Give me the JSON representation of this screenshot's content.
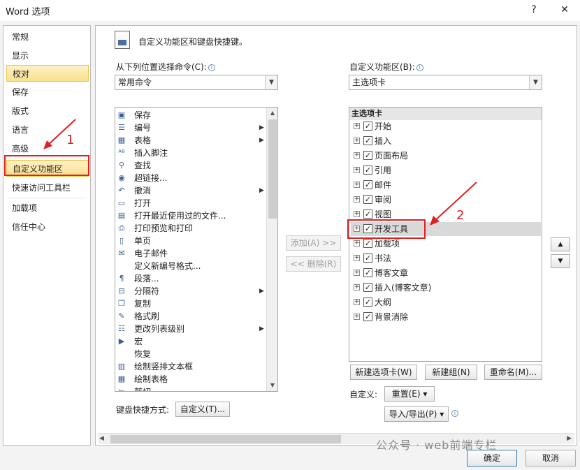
{
  "window": {
    "title": "Word 选项",
    "help": "?",
    "close": "✕"
  },
  "sidebar": {
    "items": [
      {
        "label": "常规"
      },
      {
        "label": "显示"
      },
      {
        "label": "校对"
      },
      {
        "label": "保存"
      },
      {
        "label": "版式"
      },
      {
        "label": "语言"
      },
      {
        "label": "高级"
      },
      {
        "label": "自定义功能区"
      },
      {
        "label": "快速访问工具栏"
      },
      {
        "label": "加载项"
      },
      {
        "label": "信任中心"
      }
    ]
  },
  "header": {
    "title": "自定义功能区和键盘快捷键。"
  },
  "left": {
    "label": "从下列位置选择命令(C):",
    "combo_value": "常用命令",
    "commands": [
      {
        "label": "保存",
        "icon": "save-icon",
        "glyph": "▣",
        "arrow": false
      },
      {
        "label": "编号",
        "icon": "numbering-icon",
        "glyph": "☰",
        "arrow": true
      },
      {
        "label": "表格",
        "icon": "table-icon",
        "glyph": "▦",
        "arrow": true
      },
      {
        "label": "插入脚注",
        "icon": "footnote-icon",
        "glyph": "ᴬᴮ",
        "arrow": false
      },
      {
        "label": "查找",
        "icon": "find-icon",
        "glyph": "⚲",
        "arrow": false
      },
      {
        "label": "超链接...",
        "icon": "hyperlink-icon",
        "glyph": "◉",
        "arrow": false
      },
      {
        "label": "撤消",
        "icon": "undo-icon",
        "glyph": "↶",
        "arrow": true
      },
      {
        "label": "打开",
        "icon": "open-icon",
        "glyph": "▭",
        "arrow": false
      },
      {
        "label": "打开最近使用过的文件...",
        "icon": "recent-files-icon",
        "glyph": "▤",
        "arrow": false
      },
      {
        "label": "打印预览和打印",
        "icon": "print-preview-icon",
        "glyph": "⎙",
        "arrow": false
      },
      {
        "label": "单页",
        "icon": "single-page-icon",
        "glyph": "▯",
        "arrow": false
      },
      {
        "label": "电子邮件",
        "icon": "email-icon",
        "glyph": "✉",
        "arrow": false
      },
      {
        "label": "定义新编号格式...",
        "icon": "number-format-icon",
        "glyph": "",
        "arrow": false
      },
      {
        "label": "段落...",
        "icon": "paragraph-icon",
        "glyph": "¶",
        "arrow": false
      },
      {
        "label": "分隔符",
        "icon": "separator-icon",
        "glyph": "⊟",
        "arrow": true
      },
      {
        "label": "复制",
        "icon": "copy-icon",
        "glyph": "❐",
        "arrow": false
      },
      {
        "label": "格式刷",
        "icon": "format-painter-icon",
        "glyph": "✎",
        "arrow": false
      },
      {
        "label": "更改列表级别",
        "icon": "list-level-icon",
        "glyph": "☷",
        "arrow": true
      },
      {
        "label": "宏",
        "icon": "macro-icon",
        "glyph": "▶",
        "arrow": false
      },
      {
        "label": "恢复",
        "icon": "redo-icon",
        "glyph": "",
        "arrow": false
      },
      {
        "label": "绘制竖排文本框",
        "icon": "vertical-textbox-icon",
        "glyph": "▥",
        "arrow": false
      },
      {
        "label": "绘制表格",
        "icon": "draw-table-icon",
        "glyph": "▦",
        "arrow": false
      },
      {
        "label": "剪切",
        "icon": "cut-icon",
        "glyph": "✂",
        "arrow": false
      }
    ],
    "keyboard_label": "键盘快捷方式:",
    "keyboard_button": "自定义(T)..."
  },
  "middle": {
    "add_button": "添加(A) >>",
    "remove_button": "<< 删除(R)"
  },
  "right": {
    "label": "自定义功能区(B):",
    "combo_value": "主选项卡",
    "list_header": "主选项卡",
    "tabs": [
      {
        "label": "开始"
      },
      {
        "label": "插入"
      },
      {
        "label": "页面布局"
      },
      {
        "label": "引用"
      },
      {
        "label": "邮件"
      },
      {
        "label": "审阅"
      },
      {
        "label": "视图"
      },
      {
        "label": "开发工具"
      },
      {
        "label": "加载项"
      },
      {
        "label": "书法"
      },
      {
        "label": "博客文章"
      },
      {
        "label": "插入(博客文章)"
      },
      {
        "label": "大纲"
      },
      {
        "label": "背景消除"
      }
    ],
    "new_tab_button": "新建选项卡(W)",
    "new_group_button": "新建组(N)",
    "rename_button": "重命名(M)...",
    "customize_label": "自定义:",
    "reset_button": "重置(E) ▾",
    "import_export_button": "导入/导出(P) ▾"
  },
  "annotations": {
    "label1": "1",
    "label2": "2"
  },
  "footer": {
    "ok_button": "确定",
    "cancel_button": "取消",
    "watermark": "公众号 · web前端专栏"
  }
}
